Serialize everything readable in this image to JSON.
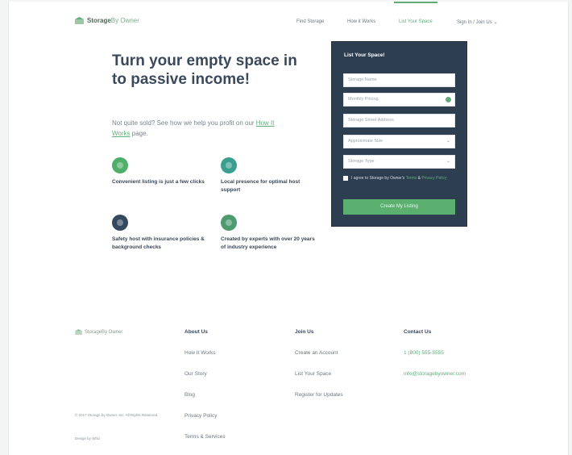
{
  "brand": {
    "name_part1": "Storage",
    "name_part2": "By Owner"
  },
  "nav": {
    "links": [
      {
        "label": "Find Storage"
      },
      {
        "label": "How it Works"
      },
      {
        "label": "List Your Space"
      },
      {
        "label": "Sign In / Join Us"
      }
    ],
    "active_index": 2
  },
  "hero": {
    "title": "Turn your empty space in to passive income!",
    "text_before": "Not quite sold? See how we help you profit on our",
    "link": "How It Works",
    "text_after": "page."
  },
  "features": [
    {
      "icon": "thumbs-up-icon",
      "color": "#4fae6a",
      "text": "Convenient listing is just a few clicks"
    },
    {
      "icon": "support-icon",
      "color": "#3a9f8f",
      "text": "Local presence for optimal host support"
    },
    {
      "icon": "shield-icon",
      "color": "#34495e",
      "text": "Safety host with insurance policies & background checks"
    },
    {
      "icon": "star-icon",
      "color": "#4c9a70",
      "text": "Created by experts with over 20 years of industry experience"
    }
  ],
  "form": {
    "title": "List Your Space!",
    "fields": [
      {
        "placeholder": "Storage Name",
        "kind": "text"
      },
      {
        "placeholder": "Monthly Pricing",
        "kind": "text-status"
      },
      {
        "placeholder": "Storage Street Address",
        "kind": "text"
      },
      {
        "placeholder": "Approximate Size",
        "kind": "select"
      },
      {
        "placeholder": "Storage Type",
        "kind": "select"
      }
    ],
    "submit": "Create My Listing",
    "agree_text": "I agree to Storage by Owner's",
    "agree_link1": "Terms",
    "agree_mid": "&",
    "agree_link2": "Privacy Policy",
    "accent": "#5bb070",
    "panel_color": "#2d3e50"
  },
  "footer": {
    "columns": [
      {
        "heading": "About Us",
        "links": [
          "How It Works",
          "Our Story",
          "Blog",
          "Privacy Policy",
          "Terms & Services"
        ],
        "green": false
      },
      {
        "heading": "Join Us",
        "links": [
          "Create an Account",
          "List Your Space",
          "Register for Updates"
        ],
        "green": false
      },
      {
        "heading": "Contact Us",
        "links": [
          "1 (800) 555-5555",
          "info@storagebyowner.com"
        ],
        "green": true
      }
    ],
    "copyright": "© 2017 Storage by Owner, Inc. All Rights Reserved.",
    "made_by": "Design by Whiz"
  }
}
